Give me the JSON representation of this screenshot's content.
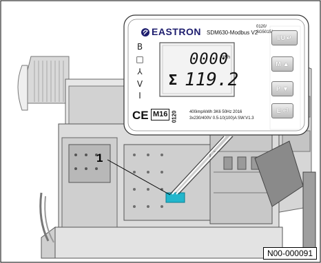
{
  "meter": {
    "brand": "EASTRON",
    "model": "SDM630-Modbus V2",
    "cert_top": "0120/",
    "cert_bottom": "SG50151",
    "lcd_row1": "0000",
    "lcd_unit": "kWh",
    "lcd_row2_symbol": "Σ",
    "lcd_row2": "119.2",
    "ce_mark": "CE",
    "metrology_mark": "M16",
    "notified_body": "0120",
    "spec_line1": "400imp/kWh  3K6  50Hz  2016",
    "spec_line2": "3x230/400V 0.5-10(100)A SW:V1.3",
    "buttons": [
      {
        "label": "I/U",
        "icon": "return-arrow-icon"
      },
      {
        "label": "M",
        "icon": "up-arrow-icon"
      },
      {
        "label": "P",
        "icon": "down-arrow-icon"
      },
      {
        "label": "E",
        "icon": "enter-arrow-icon"
      }
    ],
    "side_symbols": [
      "B",
      "□",
      "⅄",
      "V",
      "I"
    ]
  },
  "callout": {
    "label": "1"
  },
  "figure_ref": "N00-000091",
  "colors": {
    "highlight": "#22b6cc",
    "lcd_bg": "#f3f3f3",
    "line": "#5a5a5a"
  }
}
